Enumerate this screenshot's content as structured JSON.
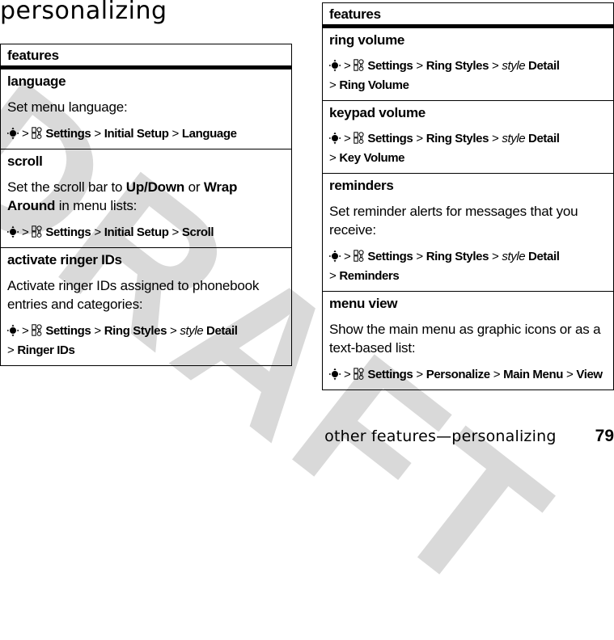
{
  "page": {
    "title": "personalizing",
    "watermark": "DRAFT",
    "footer": {
      "section": "other features—personalizing",
      "page_number": "79"
    }
  },
  "icons": {
    "nav": "nav-key-icon",
    "settings": "settings-icon"
  },
  "tables": [
    {
      "header": "features",
      "rows": [
        {
          "name": "language",
          "description": "Set menu language:",
          "path": [
            {
              "t": "Settings",
              "s": "b",
              "icon": "settings"
            },
            {
              "t": "Initial Setup",
              "s": "b"
            },
            {
              "t": "Language",
              "s": "b"
            }
          ]
        },
        {
          "name": "scroll",
          "description_parts": [
            {
              "t": "Set the scroll bar to ",
              "s": "n"
            },
            {
              "t": "Up/Down",
              "s": "b"
            },
            {
              "t": " or ",
              "s": "n"
            },
            {
              "t": "Wrap Around",
              "s": "b"
            },
            {
              "t": " in menu lists:",
              "s": "n"
            }
          ],
          "path": [
            {
              "t": "Settings",
              "s": "b",
              "icon": "settings"
            },
            {
              "t": "Initial Setup",
              "s": "b"
            },
            {
              "t": "Scroll",
              "s": "b"
            }
          ]
        },
        {
          "name": "activate ringer IDs",
          "description": "Activate ringer IDs assigned to phonebook entries and categories:",
          "path": [
            {
              "t": "Settings",
              "s": "b",
              "icon": "settings"
            },
            {
              "t": "Ring Styles",
              "s": "b"
            },
            {
              "t": "style",
              "s": "i",
              "suffix": "Detail"
            },
            {
              "t": "Ringer IDs",
              "s": "b",
              "break": true
            }
          ]
        }
      ]
    },
    {
      "header": "features",
      "rows": [
        {
          "name": "ring volume",
          "path": [
            {
              "t": "Settings",
              "s": "b",
              "icon": "settings"
            },
            {
              "t": "Ring Styles",
              "s": "b"
            },
            {
              "t": "style",
              "s": "i",
              "suffix": "Detail"
            },
            {
              "t": "Ring Volume",
              "s": "b",
              "break": true
            }
          ]
        },
        {
          "name": "keypad volume",
          "path": [
            {
              "t": "Settings",
              "s": "b",
              "icon": "settings"
            },
            {
              "t": "Ring Styles",
              "s": "b"
            },
            {
              "t": "style",
              "s": "i",
              "suffix": "Detail"
            },
            {
              "t": "Key Volume",
              "s": "b",
              "break": true
            }
          ]
        },
        {
          "name": "reminders",
          "description": "Set reminder alerts for messages that you receive:",
          "path": [
            {
              "t": "Settings",
              "s": "b",
              "icon": "settings"
            },
            {
              "t": "Ring Styles",
              "s": "b"
            },
            {
              "t": "style",
              "s": "i",
              "suffix": "Detail"
            },
            {
              "t": "Reminders",
              "s": "b",
              "break": true
            }
          ]
        },
        {
          "name": "menu view",
          "description": "Show the main menu as graphic icons or as a text-based list:",
          "path": [
            {
              "t": "Settings",
              "s": "b",
              "icon": "settings"
            },
            {
              "t": "Personalize",
              "s": "b"
            },
            {
              "t": "Main Menu",
              "s": "b"
            },
            {
              "t": "View",
              "s": "b"
            }
          ]
        }
      ]
    }
  ]
}
